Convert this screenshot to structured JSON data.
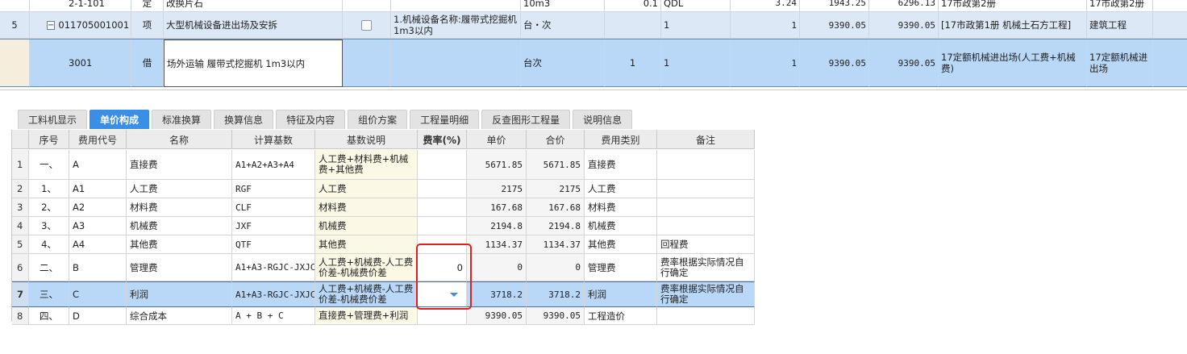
{
  "top_grid": {
    "rows": [
      {
        "row_no": "",
        "code": "2-1-101",
        "type": "定",
        "name": "改换片石",
        "feature": "",
        "unit": "10m3",
        "qty_expr": "0.1",
        "qty_code": "QDL",
        "qty": "3.24",
        "price": "1943.25",
        "total": "6296.13",
        "specialty": "17市政第2册",
        "category": "17市政第2册"
      },
      {
        "row_no": "5",
        "code": "011705001001",
        "type": "项",
        "name": "大型机械设备进出场及安拆",
        "feature": "1.机械设备名称:履带式挖掘机 1m3以内",
        "unit": "台・次",
        "qty_expr": "",
        "qty_code": "1",
        "qty": "1",
        "price": "9390.05",
        "total": "9390.05",
        "specialty": "[17市政第1册 机械土石方工程]",
        "category": "建筑工程"
      },
      {
        "row_no": "",
        "code": "3001",
        "type": "借",
        "name": "场外运输 履带式挖掘机 1m3以内",
        "feature": "",
        "unit": "台次",
        "qty_expr": "1",
        "qty_code": "1",
        "qty": "1",
        "price": "9390.05",
        "total": "9390.05",
        "specialty": "17定额机械进出场(人工费+机械费)",
        "category": "17定额机械进出场"
      }
    ]
  },
  "tabs": [
    {
      "label": "工料机显示",
      "active": false
    },
    {
      "label": "单价构成",
      "active": true
    },
    {
      "label": "标准换算",
      "active": false
    },
    {
      "label": "换算信息",
      "active": false
    },
    {
      "label": "特征及内容",
      "active": false
    },
    {
      "label": "组价方案",
      "active": false
    },
    {
      "label": "工程量明细",
      "active": false
    },
    {
      "label": "反查图形工程量",
      "active": false
    },
    {
      "label": "说明信息",
      "active": false
    }
  ],
  "cost_grid": {
    "headers": {
      "seq": "序号",
      "code": "费用代号",
      "name": "名称",
      "base": "计算基数",
      "basis": "基数说明",
      "rate": "费率(%)",
      "unit_price": "单价",
      "total": "合价",
      "category": "费用类别",
      "note": "备注"
    },
    "rows": [
      {
        "row": "1",
        "seq": "一、",
        "code": "A",
        "name": "直接费",
        "base": "A1+A2+A3+A4",
        "basis": "人工费+材料费+机械费+其他费",
        "rate": "",
        "unit_price": "5671.85",
        "total": "5671.85",
        "category": "直接费",
        "note": ""
      },
      {
        "row": "2",
        "seq": "1、",
        "code": "A1",
        "name": "人工费",
        "base": "RGF",
        "basis": "人工费",
        "rate": "",
        "unit_price": "2175",
        "total": "2175",
        "category": "人工费",
        "note": ""
      },
      {
        "row": "3",
        "seq": "2、",
        "code": "A2",
        "name": "材料费",
        "base": "CLF",
        "basis": "材料费",
        "rate": "",
        "unit_price": "167.68",
        "total": "167.68",
        "category": "材料费",
        "note": ""
      },
      {
        "row": "4",
        "seq": "3、",
        "code": "A3",
        "name": "机械费",
        "base": "JXF",
        "basis": "机械费",
        "rate": "",
        "unit_price": "2194.8",
        "total": "2194.8",
        "category": "机械费",
        "note": ""
      },
      {
        "row": "5",
        "seq": "4、",
        "code": "A4",
        "name": "其他费",
        "base": "QTF",
        "basis": "其他费",
        "rate": "",
        "unit_price": "1134.37",
        "total": "1134.37",
        "category": "其他费",
        "note": "回程费"
      },
      {
        "row": "6",
        "seq": "二、",
        "code": "B",
        "name": "管理费",
        "base": "A1+A3-RGJC-JXJC",
        "basis": "人工费+机械费-人工费价差-机械费价差",
        "rate": "0",
        "unit_price": "0",
        "total": "0",
        "category": "管理费",
        "note": "费率根据实际情况自行确定"
      },
      {
        "row": "7",
        "seq": "三、",
        "code": "C",
        "name": "利润",
        "base": "A1+A3-RGJC-JXJC",
        "basis": "人工费+机械费-人工费价差-机械费价差",
        "rate": "",
        "unit_price": "3718.2",
        "total": "3718.2",
        "category": "利润",
        "note": "费率根据实际情况自行确定"
      },
      {
        "row": "8",
        "seq": "四、",
        "code": "D",
        "name": "综合成本",
        "base": "A + B + C",
        "basis": "直接费+管理费+利润",
        "rate": "",
        "unit_price": "9390.05",
        "total": "9390.05",
        "category": "工程造价",
        "note": ""
      }
    ]
  }
}
